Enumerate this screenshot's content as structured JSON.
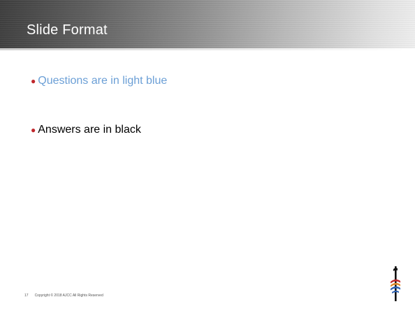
{
  "slide": {
    "title": "Slide Format",
    "bullets": [
      "Questions are in light blue",
      "Answers are in black"
    ],
    "footer": {
      "page_number": "17",
      "copyright": "Copyright © 2018 AJCC  All Rights Reserved"
    },
    "logo_icon": "ajcc-logo-icon"
  },
  "colors": {
    "question_text": "#6b9fd6",
    "answer_text": "#000000",
    "bullet_marker": "#c0282d",
    "title_text": "#ffffff"
  }
}
